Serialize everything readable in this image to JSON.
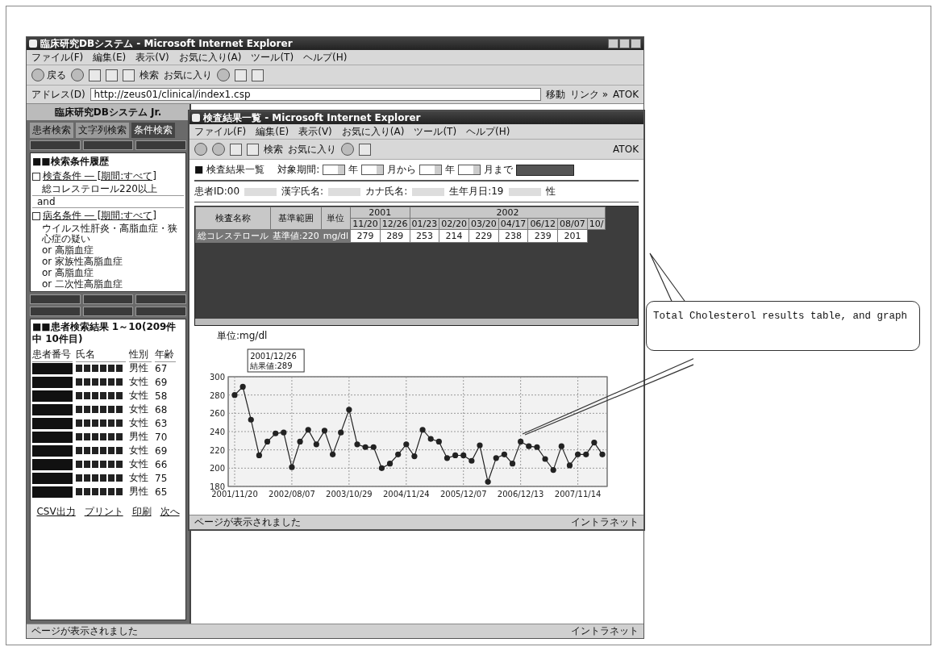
{
  "outer_window": {
    "title": "臨床研究DBシステム - Microsoft Internet Explorer",
    "menu": [
      "ファイル(F)",
      "編集(E)",
      "表示(V)",
      "お気に入り(A)",
      "ツール(T)",
      "ヘルプ(H)"
    ],
    "toolbar": {
      "back": "戻る",
      "search": "検索",
      "favorites": "お気に入り"
    },
    "address": {
      "label": "アドレス(D)",
      "value": "http://zeus01/clinical/index1.csp",
      "go": "移動",
      "links": "リンク »",
      "ime": "ATOK"
    },
    "status": {
      "text": "ページが表示されました",
      "zone": "イントラネット"
    }
  },
  "left_pane": {
    "banner": "臨床研究DBシステム Jr.",
    "tabs": [
      {
        "label": "患者検索",
        "selected": false
      },
      {
        "label": "文字列検索",
        "selected": false
      },
      {
        "label": "条件検索",
        "selected": true
      }
    ],
    "conditions_title": "■■検索条件履歴",
    "conditions": [
      {
        "kind": "group",
        "text": "検査条件 ― [期間:すべて]",
        "checked": false
      },
      {
        "kind": "item",
        "text": "総コレステロール220以上"
      },
      {
        "kind": "join",
        "text": "and"
      },
      {
        "kind": "group",
        "text": "病名条件 ― [期間:すべて]",
        "checked": false
      },
      {
        "kind": "item",
        "text": "ウイルス性肝炎・高脂血症・狭心症の疑い"
      },
      {
        "kind": "item",
        "text": "or 高脂血症"
      },
      {
        "kind": "item",
        "text": "or 家族性高脂血症"
      },
      {
        "kind": "item",
        "text": "or 高脂血症"
      },
      {
        "kind": "item",
        "text": "or 二次性高脂血症"
      }
    ],
    "results_title": "■■患者検索結果 1～10(209件中 10件目)",
    "columns": [
      "患者番号",
      "氏名",
      "性別",
      "年齢"
    ],
    "patients": [
      {
        "sex": "男性",
        "age": "67"
      },
      {
        "sex": "女性",
        "age": "69"
      },
      {
        "sex": "女性",
        "age": "58"
      },
      {
        "sex": "女性",
        "age": "68"
      },
      {
        "sex": "女性",
        "age": "63"
      },
      {
        "sex": "男性",
        "age": "70"
      },
      {
        "sex": "女性",
        "age": "69"
      },
      {
        "sex": "女性",
        "age": "66"
      },
      {
        "sex": "女性",
        "age": "75"
      },
      {
        "sex": "男性",
        "age": "65"
      }
    ],
    "links": [
      "CSV出力",
      "プリント",
      "印刷",
      "次へ"
    ]
  },
  "inner_window": {
    "title": "検査結果一覧 - Microsoft Internet Explorer",
    "menu": [
      "ファイル(F)",
      "編集(E)",
      "表示(V)",
      "お気に入り(A)",
      "ツール(T)",
      "ヘルプ(H)"
    ],
    "toolbar": {
      "search": "検索",
      "favorites": "お気に入り",
      "ime": "ATOK"
    },
    "heading": "■ 検査結果一覧",
    "period_label": "対象期間:",
    "period_units": [
      "年",
      "月から",
      "年",
      "月まで"
    ],
    "patient_info": [
      "患者ID:00",
      "漢字氏名:",
      "カナ氏名:",
      "生年月日:19",
      "性"
    ],
    "table": {
      "columns": [
        "検査名称",
        "基準範囲",
        "単位"
      ],
      "year_groups": [
        {
          "year": "2001",
          "dates": [
            "11/20",
            "12/26"
          ]
        },
        {
          "year": "2002",
          "dates": [
            "01/23",
            "02/20",
            "03/20",
            "04/17",
            "06/12",
            "08/07",
            "10/"
          ]
        }
      ],
      "row": {
        "name": "総コレステロール",
        "range": "基準値:220",
        "unit": "mg/dl",
        "values": [
          "279",
          "289",
          "253",
          "214",
          "229",
          "238",
          "239",
          "201"
        ]
      }
    },
    "chart_unit": "単位:mg/dl",
    "tooltip": [
      "2001/12/26",
      "結果値:289"
    ],
    "chart_data": {
      "type": "line",
      "categories": [
        "2001/11/20",
        null,
        null,
        null,
        null,
        null,
        null,
        "2002/08/07",
        null,
        null,
        null,
        null,
        null,
        null,
        "2003/10/29",
        null,
        null,
        null,
        null,
        null,
        null,
        "2004/11/24",
        null,
        null,
        null,
        null,
        null,
        null,
        "2005/12/07",
        null,
        null,
        null,
        null,
        null,
        null,
        "2006/12/13",
        null,
        null,
        null,
        null,
        null,
        null,
        "2007/11/14",
        null,
        null,
        null
      ],
      "grid": true,
      "series": [
        {
          "color": "#222222",
          "marker": "circle",
          "values": [
            280,
            289,
            253,
            214,
            229,
            238,
            239,
            201,
            229,
            242,
            226,
            241,
            215,
            239,
            264,
            226,
            223,
            223,
            200,
            205,
            215,
            226,
            213,
            242,
            232,
            229,
            211,
            214,
            214,
            208,
            225,
            185,
            211,
            215,
            205,
            229,
            224,
            223,
            210,
            198,
            224,
            203,
            215,
            215,
            228,
            215
          ]
        }
      ],
      "ylim": [
        180,
        300
      ],
      "yticks": [
        180,
        200,
        220,
        240,
        260,
        280,
        300
      ]
    },
    "status": {
      "text": "ページが表示されました",
      "zone": "イントラネット"
    }
  },
  "callout": {
    "text": "Total Cholesterol results table, and graph"
  }
}
